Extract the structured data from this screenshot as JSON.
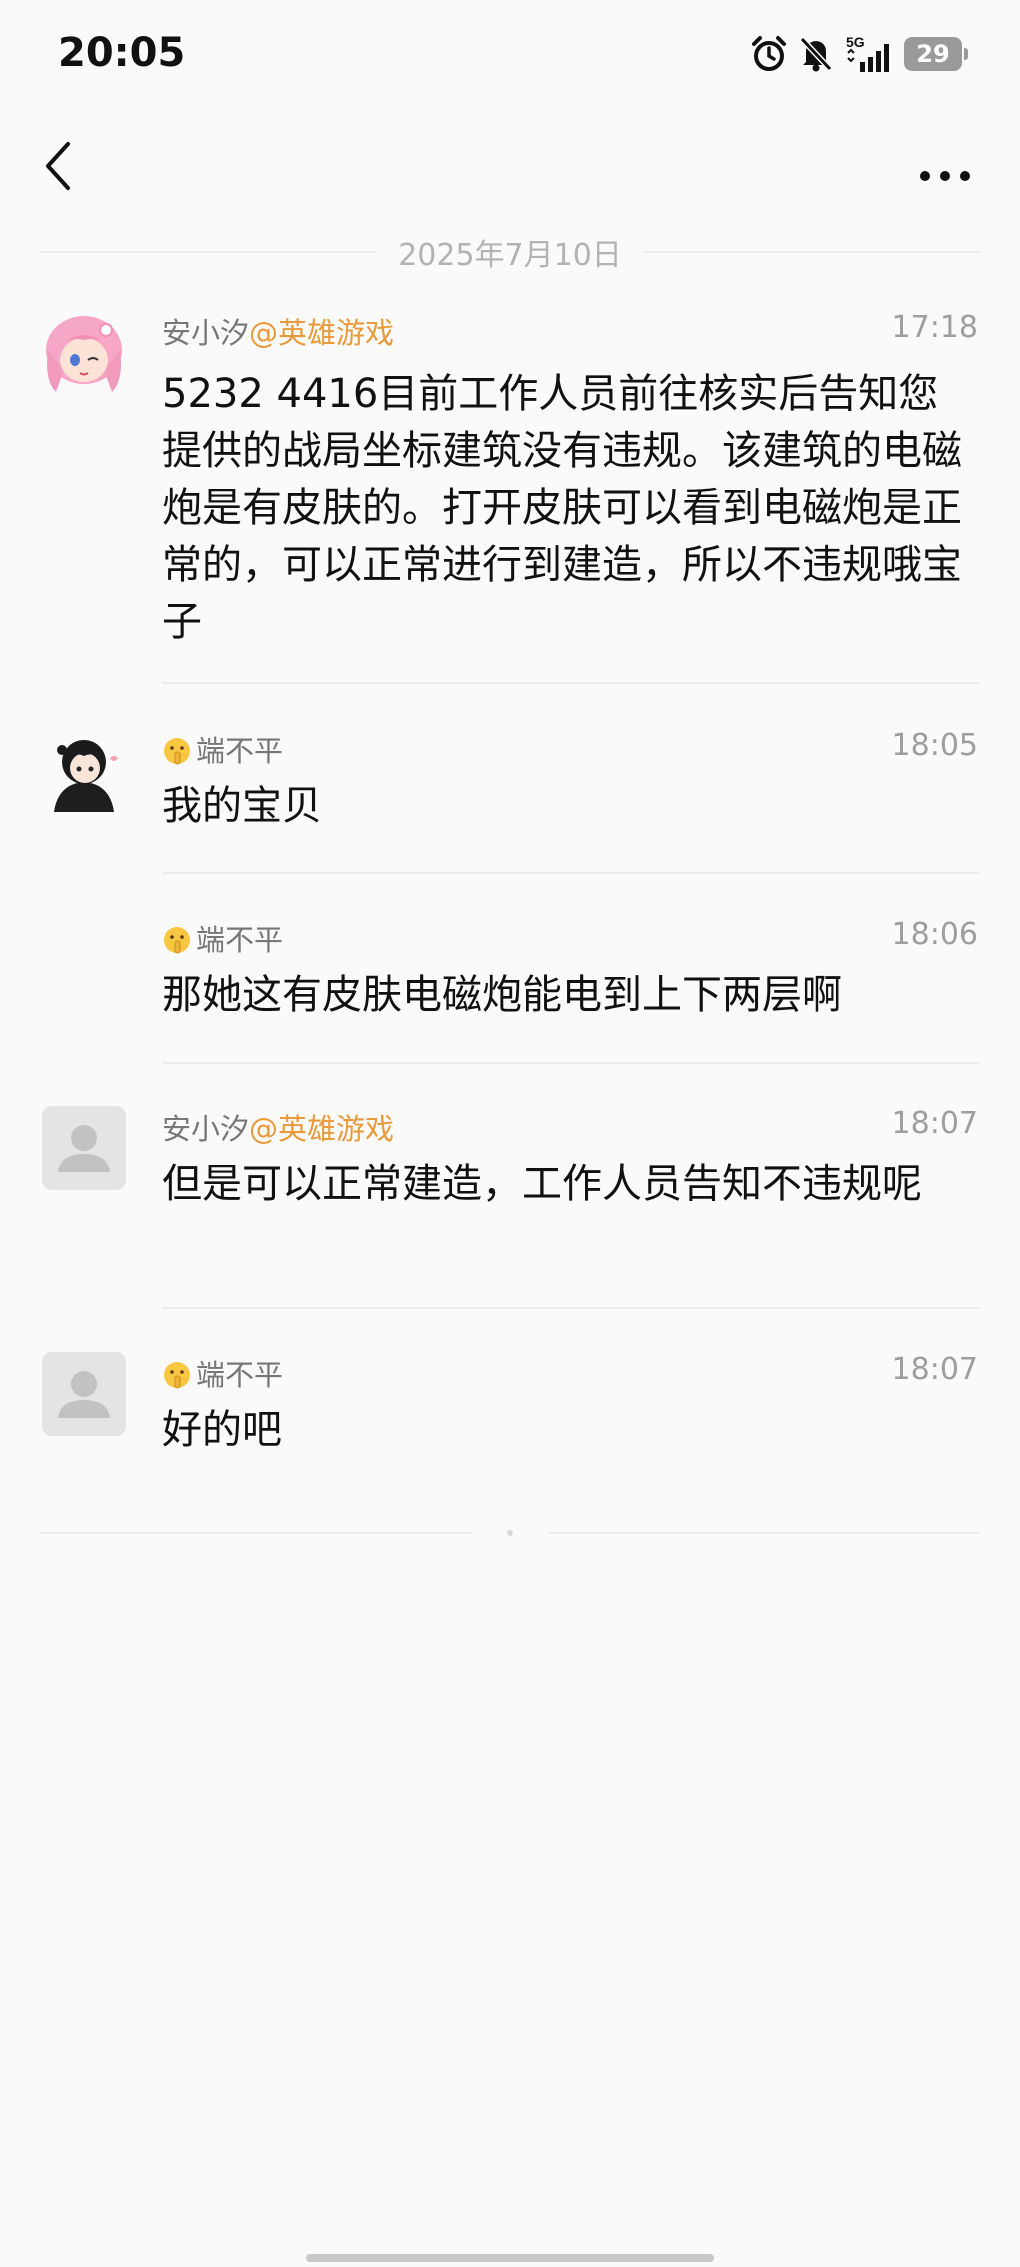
{
  "status_bar": {
    "time": "20:05",
    "network": "5G",
    "battery": "29",
    "icons": [
      "alarm-icon",
      "mute-bell-icon",
      "signal-icon",
      "battery-icon"
    ]
  },
  "nav": {
    "back_icon": "chevron-left-icon",
    "more_icon": "more-horizontal-icon"
  },
  "date_separator": "2025年7月10日",
  "messages": [
    {
      "sender": "安小汐",
      "sender_tag": "@英雄游戏",
      "time": "17:18",
      "avatar": "anime-girl-avatar",
      "text": "5232 4416目前工作人员前往核实后告知您提供的战局坐标建筑没有违规。该建筑的电磁炮是有皮肤的。打开皮肤可以看到电磁炮是正常的，可以正常进行到建造，所以不违规哦宝子"
    },
    {
      "sender": "端不平",
      "sender_tag": "",
      "sender_emoji": "shushing-face-icon",
      "time": "18:05",
      "avatar": "dark-hair-girl-avatar",
      "text": "我的宝贝"
    },
    {
      "sender": "端不平",
      "sender_tag": "",
      "sender_emoji": "shushing-face-icon",
      "time": "18:06",
      "avatar": "",
      "text": "那她这有皮肤电磁炮能电到上下两层啊"
    },
    {
      "sender": "安小汐",
      "sender_tag": "@英雄游戏",
      "time": "18:07",
      "avatar": "default-user-avatar",
      "text": "但是可以正常建造，工作人员告知不违规呢"
    },
    {
      "sender": "端不平",
      "sender_tag": "",
      "sender_emoji": "shushing-face-icon",
      "time": "18:07",
      "avatar": "default-user-avatar",
      "text": "好的吧"
    }
  ],
  "colors": {
    "background": "#fafafa",
    "tag": "#e99a3b",
    "muted": "#9e9e9e"
  }
}
